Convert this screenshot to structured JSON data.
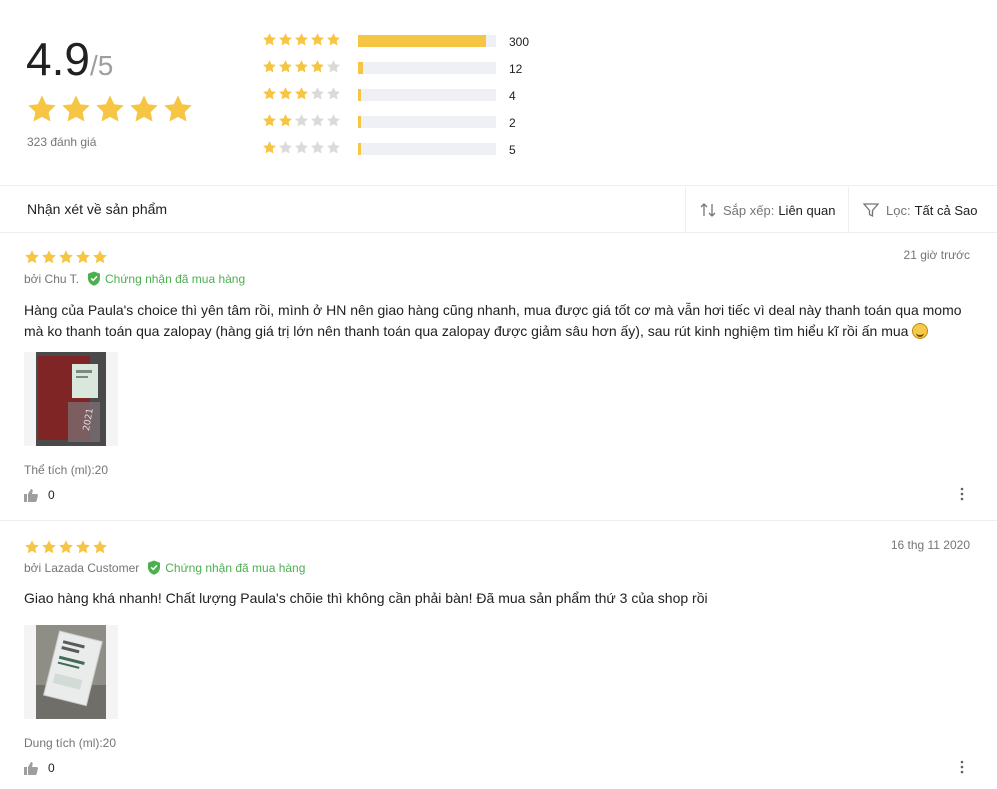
{
  "summary": {
    "score": "4.9",
    "out_of": "/5",
    "rating_count_text": "323 đánh giá",
    "distribution": [
      {
        "stars": 5,
        "count": "300",
        "fraction": 0.93
      },
      {
        "stars": 4,
        "count": "12",
        "fraction": 0.037
      },
      {
        "stars": 3,
        "count": "4",
        "fraction": 0.012
      },
      {
        "stars": 2,
        "count": "2",
        "fraction": 0.006
      },
      {
        "stars": 1,
        "count": "5",
        "fraction": 0.015
      }
    ]
  },
  "toolbar": {
    "heading": "Nhận xét về sản phẩm",
    "sort_label": "Sắp xếp:",
    "sort_value": "Liên quan",
    "filter_label": "Lọc:",
    "filter_value": "Tất cả Sao"
  },
  "reviews": [
    {
      "rating": 5,
      "date": "21 giờ trước",
      "author": "bởi Chu T.",
      "verified": "Chứng nhận đã mua hàng",
      "body": "Hàng của Paula's choice thì yên tâm rồi, mình ở HN nên giao hàng cũng nhanh, mua được giá tốt cơ mà vẫn hơi tiếc vì deal này thanh toán qua momo mà ko thanh toán qua zalopay (hàng giá trị lớn nên thanh toán qua zalopay được giảm sâu hơn ấy), sau rút kinh nghiệm tìm hiểu kĩ rồi ấn mua",
      "variant": "Thể tích (ml):20",
      "likes": "0"
    },
    {
      "rating": 5,
      "date": "16 thg 11 2020",
      "author": "bởi Lazada Customer",
      "verified": "Chứng nhận đã mua hàng",
      "body": "Giao hàng khá nhanh! Chất lượng Paula's chõie thì không cần phải bàn! Đã mua sản phẩm thứ 3 của shop rồi",
      "variant": "Dung tích (ml):20",
      "likes": "0"
    }
  ],
  "colors": {
    "star": "#f6c543",
    "star_empty": "#dadada",
    "verified": "#4caf50",
    "bar_bg": "#eff0f5"
  },
  "icons": {
    "sort": "sort-arrows-icon",
    "filter": "funnel-icon",
    "verified": "shield-check-icon",
    "like": "thumbs-up-icon",
    "more": "more-vertical-icon"
  }
}
